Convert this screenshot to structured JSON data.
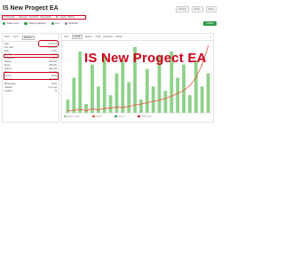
{
  "header": {
    "title": "IS New Progect EA",
    "actions": [
      "Settings",
      "Delete",
      "Share"
    ]
  },
  "breadcrumb": [
    "IS New EA",
    "Example",
    "Technical",
    "Automation",
    "EA",
    "Good",
    "Market"
  ],
  "status": {
    "items": [
      "Trade server",
      "Trading strategies",
      "Live",
      "Notebook"
    ],
    "start_label": "Publish"
  },
  "left_panel": {
    "tabs": [
      "Stats",
      "Items",
      "Backtest"
    ],
    "active_tab": "Backtest",
    "rows": [
      {
        "label": "Gain",
        "value": "+209.40%",
        "tone": "pos"
      },
      {
        "label": "Abs. Gain",
        "value": "+105.60%",
        "tone": "pos"
      },
      {
        "label": "Daily",
        "value": "0.12%",
        "tone": "plain"
      },
      {
        "label": "Monthly",
        "value": "3.60%",
        "tone": "plain"
      },
      {
        "label": "Drawdown",
        "value": "8.88%",
        "tone": "neg"
      },
      {
        "label": "Balance",
        "value": "$20,940",
        "tone": "plain"
      },
      {
        "label": "Equity",
        "value": "$20,940",
        "tone": "plain"
      },
      {
        "label": "Highest",
        "value": "$21,002",
        "tone": "plain"
      },
      {
        "label": "Profit",
        "value": "$10,940",
        "tone": "pos"
      },
      {
        "label": "Interest",
        "value": "$0.00",
        "tone": "plain"
      },
      {
        "label": "Deposits",
        "value": "$10,000",
        "tone": "plain"
      },
      {
        "label": "Withdrawals",
        "value": "$0.00",
        "tone": "plain"
      },
      {
        "label": "Updated",
        "value": "1 min ago",
        "tone": "plain"
      },
      {
        "label": "Tracking",
        "value": "12",
        "tone": "plain"
      }
    ]
  },
  "right_panel": {
    "tabs": [
      "Chart",
      "Growth",
      "Balance",
      "Profit",
      "Drawdown",
      "Margin"
    ],
    "active_tab": "Growth"
  },
  "overlay_text": "IS New Progect EA",
  "chart_data": {
    "type": "bar",
    "categories": [
      "1",
      "2",
      "3",
      "4",
      "5",
      "6",
      "7",
      "8",
      "9",
      "10",
      "11",
      "12",
      "13",
      "14",
      "15",
      "16",
      "17",
      "18",
      "19",
      "20",
      "21",
      "22",
      "23",
      "24"
    ],
    "series": [
      {
        "values": [
          3,
          8,
          14,
          2,
          11,
          6,
          13,
          4,
          9,
          12,
          7,
          15,
          3,
          10,
          6,
          13,
          5,
          14,
          8,
          11,
          4,
          12,
          6,
          9
        ]
      },
      {
        "values": [
          0.4,
          0.6,
          0.8,
          0.5,
          0.9,
          0.7,
          1.0,
          1.1,
          1.3,
          1.2,
          1.5,
          1.8,
          2.0,
          2.3,
          2.6,
          2.9,
          3.3,
          3.8,
          4.4,
          5.1,
          6.2,
          8.0,
          11.0,
          15.2
        ]
      }
    ],
    "legend": [
      "Equity Growth",
      "Growth",
      "Deposits",
      "Withdrawals"
    ],
    "colors": {
      "bars": "#8fd18a",
      "line": "#e8573c",
      "accent_red": "#d0021b",
      "green": "#2e9b4a"
    },
    "ylim": [
      0,
      16
    ]
  }
}
